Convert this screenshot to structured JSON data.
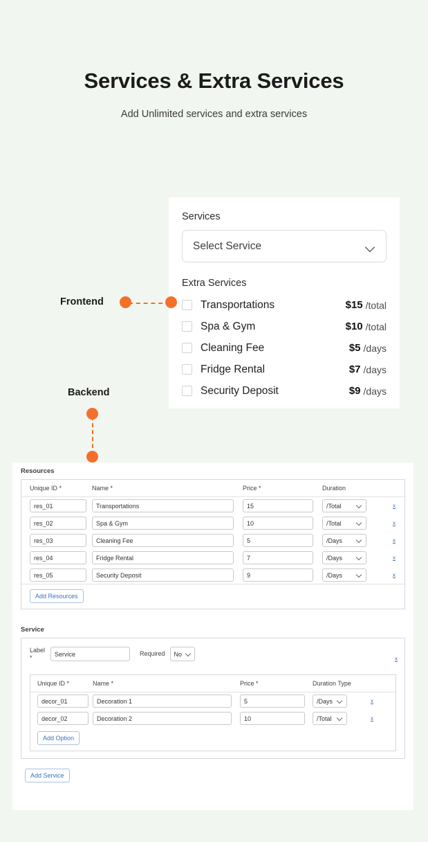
{
  "header": {
    "title": "Services & Extra Services",
    "subtitle": "Add Unlimited services and extra services"
  },
  "annotations": {
    "frontend_label": "Frontend",
    "backend_label": "Backend",
    "accent_color": "#f4702a"
  },
  "frontend": {
    "services_label": "Services",
    "select_placeholder": "Select Service",
    "extra_services_label": "Extra Services",
    "extras": [
      {
        "name": "Transportations",
        "price": "$15",
        "unit": "/total"
      },
      {
        "name": "Spa & Gym",
        "price": "$10",
        "unit": "/total"
      },
      {
        "name": "Cleaning Fee",
        "price": "$5",
        "unit": "/days"
      },
      {
        "name": "Fridge Rental",
        "price": "$7",
        "unit": "/days"
      },
      {
        "name": "Security Deposit",
        "price": "$9",
        "unit": "/days"
      }
    ]
  },
  "backend": {
    "resources": {
      "section_title": "Resources",
      "columns": [
        "Unique ID *",
        "Name *",
        "Price *",
        "Duration"
      ],
      "rows": [
        {
          "id": "res_01",
          "name": "Transportations",
          "price": "15",
          "duration": "/Total",
          "remove": "x"
        },
        {
          "id": "res_02",
          "name": "Spa & Gym",
          "price": "10",
          "duration": "/Total",
          "remove": "x"
        },
        {
          "id": "res_03",
          "name": "Cleaning Fee",
          "price": "5",
          "duration": "/Days",
          "remove": "x"
        },
        {
          "id": "res_04",
          "name": "Fridge Rental",
          "price": "7",
          "duration": "/Days",
          "remove": "x"
        },
        {
          "id": "res_05",
          "name": "Security Deposit",
          "price": "9",
          "duration": "/Days",
          "remove": "x"
        }
      ],
      "add_button": "Add Resources"
    },
    "service": {
      "section_title": "Service",
      "label_caption": "Label *",
      "label_value": "Service",
      "required_caption": "Required",
      "required_value": "No",
      "remove": "x",
      "columns": [
        "Unique ID *",
        "Name *",
        "Price *",
        "Duration Type"
      ],
      "rows": [
        {
          "id": "decor_01",
          "name": "Decoration 1",
          "price": "5",
          "duration": "/Days",
          "remove": "x"
        },
        {
          "id": "decor_02",
          "name": "Decoration 2",
          "price": "10",
          "duration": "/Total",
          "remove": "x"
        }
      ],
      "add_option_button": "Add Option",
      "add_service_button": "Add Service"
    }
  }
}
